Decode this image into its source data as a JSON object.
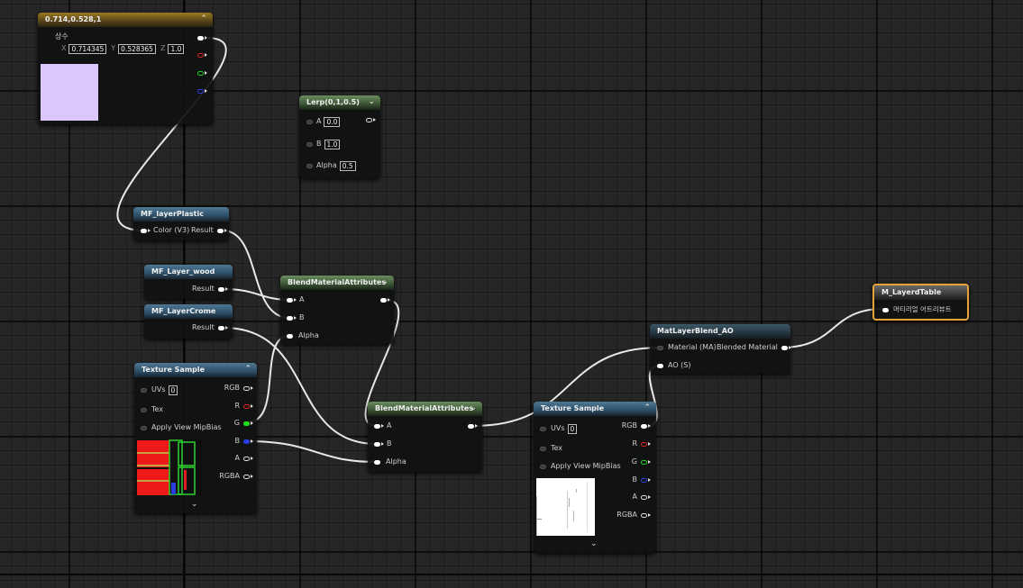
{
  "nodes": {
    "constant3": {
      "title": "0.714,0.528,1",
      "subtitle": "상수",
      "x_label": "X",
      "x_value": "0.714345",
      "y_label": "Y",
      "y_value": "0.528365",
      "z_label": "Z",
      "z_value": "1.0",
      "swatch_color": "#dcc6fc"
    },
    "lerp": {
      "title": "Lerp(0,1,0.5)",
      "a_label": "A",
      "a_value": "0.0",
      "b_label": "B",
      "b_value": "1.0",
      "alpha_label": "Alpha",
      "alpha_value": "0.5"
    },
    "mf_plastic": {
      "title": "MF_layerPlastic",
      "input_label": "Color (V3)",
      "output_label": "Result"
    },
    "mf_wood": {
      "title": "MF_Layer_wood",
      "output_label": "Result"
    },
    "mf_crome": {
      "title": "MF_LayerCrome",
      "output_label": "Result"
    },
    "blend1": {
      "title": "BlendMaterialAttributes",
      "a_label": "A",
      "b_label": "B",
      "alpha_label": "Alpha"
    },
    "blend2": {
      "title": "BlendMaterialAttributes",
      "a_label": "A",
      "b_label": "B",
      "alpha_label": "Alpha"
    },
    "texture1": {
      "title": "Texture Sample",
      "uvs_label": "UVs",
      "uvs_value": "0",
      "tex_label": "Tex",
      "mip_label": "Apply View MipBias",
      "outputs": [
        "RGB",
        "R",
        "G",
        "B",
        "A",
        "RGBA"
      ]
    },
    "texture2": {
      "title": "Texture Sample",
      "uvs_label": "UVs",
      "uvs_value": "0",
      "tex_label": "Tex",
      "mip_label": "Apply View MipBias",
      "outputs": [
        "RGB",
        "R",
        "G",
        "B",
        "A",
        "RGBA"
      ]
    },
    "matlayerblend": {
      "title": "MatLayerBlend_AO",
      "material_label": "Material (MA)",
      "output_label": "Blended Material",
      "ao_label": "AO (S)"
    },
    "result": {
      "title": "M_LayerdTable",
      "input_label": "머티리얼 어트리뷰트"
    }
  },
  "colors": {
    "grid_background": "#262626",
    "wire": "#e8e8e8",
    "selection_outline": "#e8a23a",
    "pin_red": "#e02020",
    "pin_green": "#20d020",
    "pin_blue": "#2a3de0"
  },
  "icons": [
    "collapse-chevron-icon",
    "expand-chevron-icon",
    "exec-arrow-icon"
  ]
}
